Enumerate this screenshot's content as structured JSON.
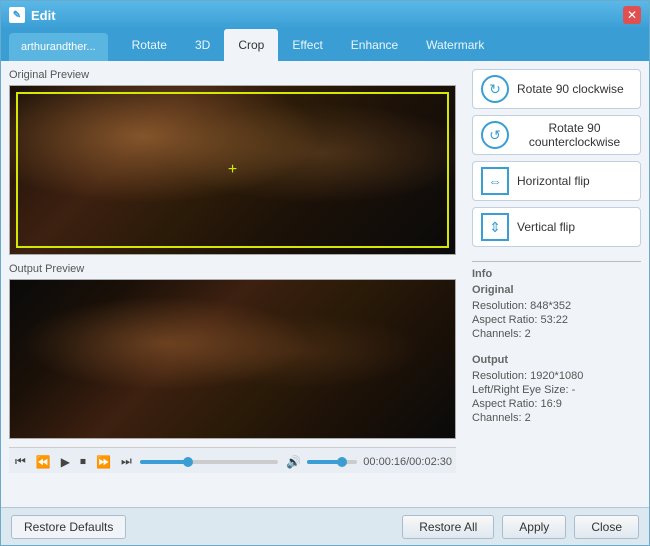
{
  "window": {
    "title": "Edit",
    "close_label": "✕"
  },
  "file_tab": {
    "label": "arthurandther..."
  },
  "tabs": [
    {
      "label": "Rotate",
      "active": false
    },
    {
      "label": "3D",
      "active": false
    },
    {
      "label": "Crop",
      "active": true
    },
    {
      "label": "Effect",
      "active": false
    },
    {
      "label": "Enhance",
      "active": false
    },
    {
      "label": "Watermark",
      "active": false
    }
  ],
  "original_preview": {
    "label": "Original Preview"
  },
  "output_preview": {
    "label": "Output Preview"
  },
  "rotate_buttons": [
    {
      "label": "Rotate 90 clockwise",
      "icon": "↻"
    },
    {
      "label": "Rotate 90 counterclockwise",
      "icon": "↺"
    },
    {
      "label": "Horizontal flip",
      "icon": "⇔"
    },
    {
      "label": "Vertical flip",
      "icon": "⇕"
    }
  ],
  "info": {
    "section_label": "Info",
    "original_label": "Original",
    "original_resolution": "Resolution: 848*352",
    "original_aspect": "Aspect Ratio: 53:22",
    "original_channels": "Channels: 2",
    "output_label": "Output",
    "output_resolution": "Resolution: 1920*1080",
    "output_leftright": "Left/Right Eye Size: -",
    "output_aspect": "Aspect Ratio: 16:9",
    "output_channels": "Channels: 2"
  },
  "player": {
    "time": "00:00:16/00:02:30"
  },
  "bottom": {
    "restore_defaults": "Restore Defaults",
    "restore_all": "Restore All",
    "apply": "Apply",
    "close": "Close"
  }
}
